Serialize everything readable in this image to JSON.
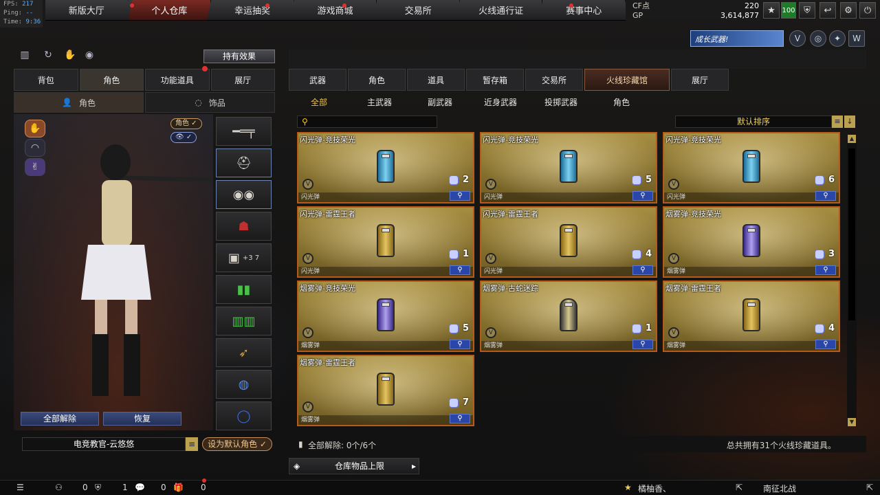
{
  "hud": {
    "fps_label": "FPS:",
    "fps": "217",
    "ping_label": "Ping:",
    "ping": "--",
    "time_label": "Time:",
    "time": "9:36"
  },
  "topnav": [
    "新版大厅",
    "个人仓库",
    "幸运抽奖",
    "游戏商城",
    "交易所",
    "火线通行证",
    "赛事中心"
  ],
  "currency": {
    "cf_label": "CF点",
    "cf": "220",
    "gp_label": "GP",
    "gp": "3,614,877"
  },
  "level": "100",
  "banner": "成长武器!",
  "effect_btn": "持有效果",
  "left_tabs": [
    "背包",
    "角色",
    "功能道具",
    "展厅"
  ],
  "left_subtabs": [
    "角色",
    "饰品"
  ],
  "char_pills": {
    "role": "角色 ✓",
    "view": "✓"
  },
  "slot_extra": "+3 7",
  "left_buttons": {
    "unequip_all": "全部解除",
    "restore": "恢复"
  },
  "char_name": "电竞教官-云悠悠",
  "set_default": "设为默认角色 ✓",
  "right_tabs": [
    "武器",
    "角色",
    "道具",
    "暂存箱",
    "交易所",
    "火线珍藏馆",
    "展厅"
  ],
  "right_subtabs": [
    "全部",
    "主武器",
    "副武器",
    "近身武器",
    "投掷武器",
    "角色"
  ],
  "sort_label": "默认排序",
  "items": [
    {
      "name": "闪光弹-竞技荣光",
      "type": "闪光弹",
      "count": "2",
      "style": "blue"
    },
    {
      "name": "闪光弹-竞技荣光",
      "type": "闪光弹",
      "count": "5",
      "style": "blue"
    },
    {
      "name": "闪光弹-竞技荣光",
      "type": "闪光弹",
      "count": "6",
      "style": "blue"
    },
    {
      "name": "闪光弹-雷霆王者",
      "type": "闪光弹",
      "count": "1",
      "style": "gold"
    },
    {
      "name": "闪光弹-雷霆王者",
      "type": "闪光弹",
      "count": "4",
      "style": "gold"
    },
    {
      "name": "烟雾弹-竞技荣光",
      "type": "烟雾弹",
      "count": "3",
      "style": "purple"
    },
    {
      "name": "烟雾弹-竞技荣光",
      "type": "烟雾弹",
      "count": "5",
      "style": "purple"
    },
    {
      "name": "烟雾弹-古蛇迷踪",
      "type": "烟雾弹",
      "count": "1",
      "style": "snake"
    },
    {
      "name": "烟雾弹-雷霆王者",
      "type": "烟雾弹",
      "count": "4",
      "style": "gold"
    },
    {
      "name": "烟雾弹-雷霆王者",
      "type": "烟雾弹",
      "count": "7",
      "style": "gold"
    }
  ],
  "footer": {
    "unequip": "全部解除: 0个/6个",
    "total": "总共拥有31个火线珍藏道具。"
  },
  "repo_limit": "仓库物品上限",
  "bottom": {
    "c1": "0",
    "c2": "1",
    "c3": "0",
    "c4": "0",
    "player1": "橘柚香、",
    "player2": "南征北战"
  },
  "colors": {
    "accent": "#b85a1a",
    "active_tab": "#7a2a22",
    "gold": "#f0c040"
  }
}
